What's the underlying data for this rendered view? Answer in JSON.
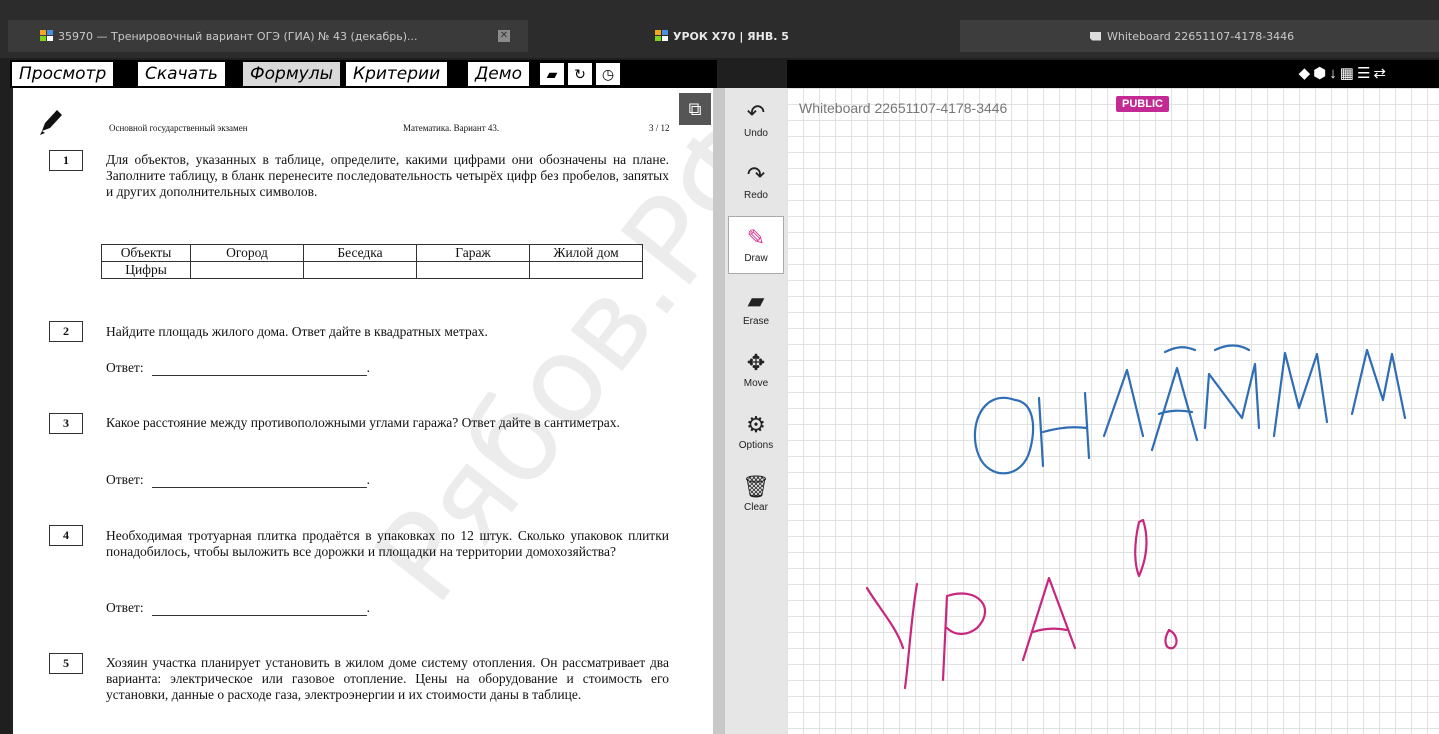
{
  "tabs": [
    {
      "label": "35970 — Тренировочный вариант ОГЭ (ГИА) № 43 (декабрь)..."
    },
    {
      "label": "УРОК Х70 | ЯНВ. 5"
    },
    {
      "label": "Whiteboard 22651107-4178-3446"
    }
  ],
  "menu": {
    "items": [
      "Просмотр",
      "Скачать",
      "Формулы",
      "Критерии",
      "Демо"
    ],
    "selected": "Формулы"
  },
  "document": {
    "header_left": "Основной государственный экзамен",
    "header_center": "Математика. Вариант 43.",
    "page": "3 / 12",
    "questions": [
      {
        "num": "1",
        "text": "Для объектов, указанных в таблице, определите, какими цифрами они обозначены на плане. Заполните таблицу, в бланк перенесите последовательность четырёх цифр без пробелов, запятых и других дополнительных символов."
      },
      {
        "num": "2",
        "text": "Найдите площадь жилого дома. Ответ дайте в квадратных метрах."
      },
      {
        "num": "3",
        "text": "Какое расстояние между противоположными углами гаража? Ответ дайте в сантиметрах."
      },
      {
        "num": "4",
        "text": "Необходимая тротуарная плитка продаётся в упаковках по 12 штук. Сколько упаковок плитки понадобилось, чтобы выложить все дорожки и площадки на территории домохозяйства?"
      },
      {
        "num": "5",
        "text": "Хозяин участка планирует установить в жилом доме систему отопления. Он рассматривает два варианта: электрическое или газовое отопление. Цены на оборудование и стоимость его установки, данные о расходе газа, электроэнергии и их стоимости даны в таблице."
      }
    ],
    "table": {
      "row1": [
        "Объекты",
        "Огород",
        "Беседка",
        "Гараж",
        "Жилой дом"
      ],
      "row2_label": "Цифры"
    },
    "answer_label": "Ответ:",
    "watermark": "Рябов.РФ"
  },
  "toolbar": {
    "tools": [
      {
        "label": "Undo",
        "icon": "undo-icon"
      },
      {
        "label": "Redo",
        "icon": "redo-icon"
      },
      {
        "label": "Draw",
        "icon": "pencil-icon"
      },
      {
        "label": "Erase",
        "icon": "eraser-icon"
      },
      {
        "label": "Move",
        "icon": "move-icon"
      },
      {
        "label": "Options",
        "icon": "gear-icon"
      },
      {
        "label": "Clear",
        "icon": "trash-icon"
      }
    ],
    "active": "Draw"
  },
  "whiteboard": {
    "title": "Whiteboard 22651107-4178-3446",
    "badge": "PUBLIC",
    "colors": {
      "blue_ink": "#2f6db5",
      "pink_ink": "#c8277f",
      "badge": "#c42a94"
    }
  }
}
